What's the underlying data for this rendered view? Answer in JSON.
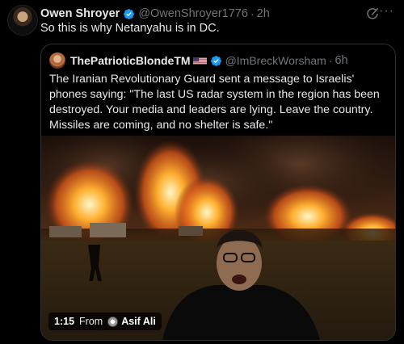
{
  "post": {
    "author_name": "Owen Shroyer",
    "author_handle": "@OwenShroyer1776",
    "time": "2h",
    "text": "So this is why Netanyahu is in DC."
  },
  "quoted": {
    "author_name": "ThePatrioticBlondeTM",
    "author_handle": "@ImBreckWorsham",
    "time": "6h",
    "text": "The Iranian Revolutionary Guard sent a message to Israelis' phones saying:  \"The last US radar system in the region has been destroyed. Your media and leaders are lying. Leave the country. Missiles are coming, and no shelter is safe.\"",
    "video": {
      "duration": "1:15",
      "from_label": "From",
      "source_name": "Asif Ali"
    }
  },
  "icons": {
    "verified": "verified-badge-icon",
    "grok": "grok-icon",
    "more": "more-icon",
    "flag": "us-flag-icon"
  },
  "colors": {
    "background": "#000000",
    "text": "#e7e9ea",
    "secondary": "#71767b",
    "verified": "#1d9bf0",
    "border": "#2f3336"
  }
}
